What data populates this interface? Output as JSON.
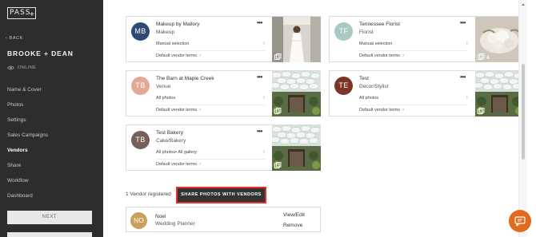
{
  "sidebar": {
    "logo": "PASS",
    "logo_mark": "+",
    "back_label": "‹  BACK",
    "event_name": "BROOKE + DEAN",
    "status": "ONLINE",
    "nav": [
      {
        "label": "Name & Cover"
      },
      {
        "label": "Photos"
      },
      {
        "label": "Settings"
      },
      {
        "label": "Sales Campaigns"
      },
      {
        "label": "Vendors"
      },
      {
        "label": "Share"
      },
      {
        "label": "Workflow"
      },
      {
        "label": "Dashboard"
      }
    ],
    "active_nav": "Vendors",
    "next_label": "NEXT"
  },
  "vendors": [
    {
      "initials": "MB",
      "name": "Makeup by Mallory",
      "type": "Makeup",
      "selection": "Manual selection",
      "terms": "Default vendor terms",
      "avatar_color": "#2e4a73",
      "thumb": "bride",
      "thumb_count": ""
    },
    {
      "initials": "TF",
      "name": "Tennessee Florist",
      "type": "Florist",
      "selection": "Manual selection",
      "terms": "Default vendor terms",
      "avatar_color": "#a9c9c3",
      "thumb": "flowers",
      "thumb_count": "4"
    },
    {
      "initials": "TB",
      "name": "The Barn at Maple Creek",
      "type": "Venue",
      "selection": "All photos",
      "terms": "Default vendor terms",
      "avatar_color": "#e3a995",
      "thumb": "umbrellas",
      "thumb_count": ""
    },
    {
      "initials": "TE",
      "name": "Test",
      "type": "Decor/Stylist",
      "selection": "All photos",
      "terms": "Default vendor terms",
      "avatar_color": "#7b3426",
      "thumb": "umbrellas",
      "thumb_count": ""
    },
    {
      "initials": "TB",
      "name": "Test Bakery",
      "type": "Cake/Bakery",
      "selection": "All photos• All gallery",
      "terms": "Default vendor terms",
      "avatar_color": "#785f5a",
      "thumb": "umbrellas",
      "thumb_count": ""
    }
  ],
  "registered_text": "1 Vendor registered",
  "share_button": "SHARE PHOTOS WITH VENDORS",
  "registered_vendor": {
    "initials": "NO",
    "name": "Noel",
    "role": "Wedding Planner",
    "view_edit": "View/Edit",
    "remove": "Remove"
  },
  "dots": "•••",
  "icons": {
    "chat": "chat-bubble-icon",
    "eye": "eye-icon",
    "copy": "copy-icon"
  },
  "colors": {
    "sidebar_bg": "#2d2d2d",
    "chat_btn": "#e06b1f",
    "highlight_border": "#e03030"
  }
}
